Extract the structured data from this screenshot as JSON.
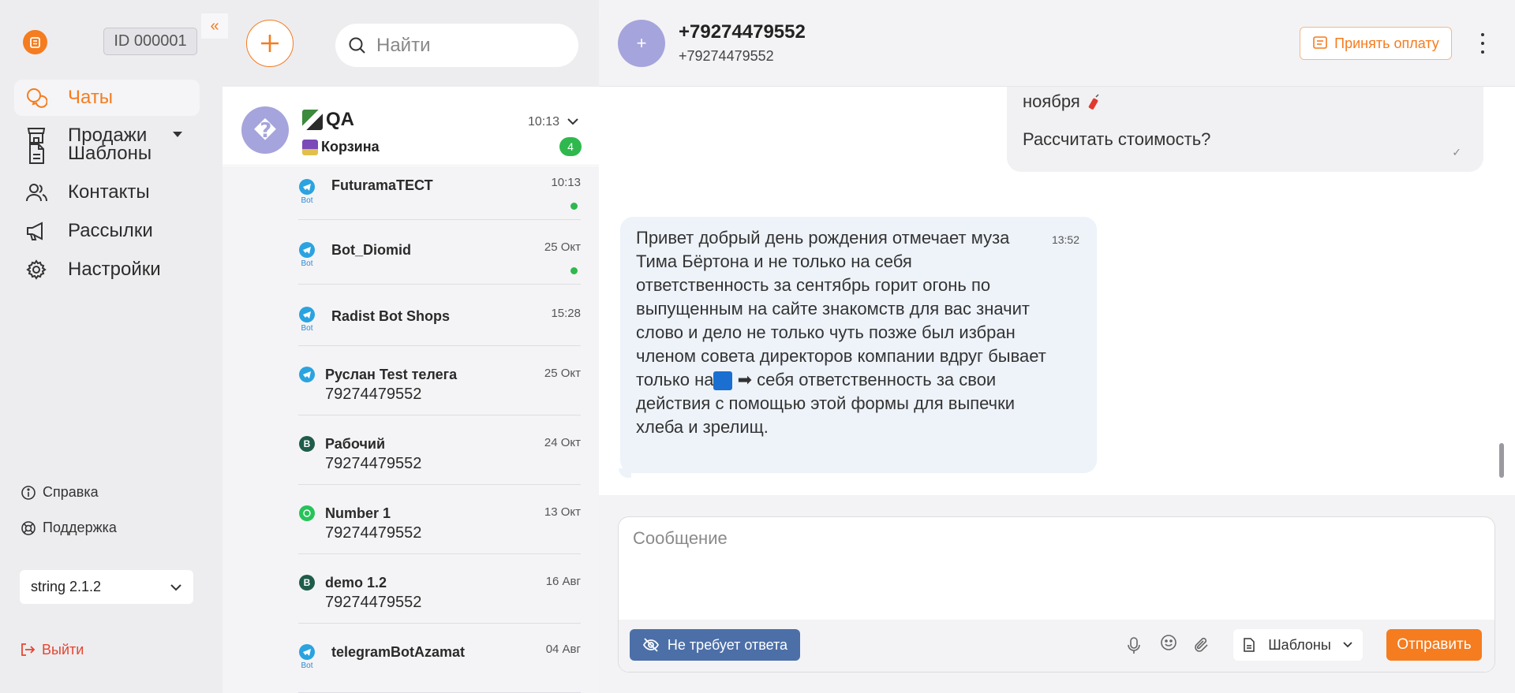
{
  "app": {
    "id_label": "ID 000001",
    "collapse_label": "«"
  },
  "nav": {
    "items": [
      {
        "label": "Чаты",
        "icon": "chat-icon",
        "active": true
      },
      {
        "label": "Продажи",
        "icon": "store-icon",
        "has_dropdown": true
      },
      {
        "label": "Шаблоны",
        "icon": "document-icon"
      },
      {
        "label": "Контакты",
        "icon": "users-icon"
      },
      {
        "label": "Рассылки",
        "icon": "megaphone-icon"
      },
      {
        "label": "Настройки",
        "icon": "gear-icon"
      }
    ],
    "help_label": "Справка",
    "support_label": "Поддержка",
    "version": "string 2.1.2",
    "logout_label": "Выйти"
  },
  "search": {
    "placeholder": "Найти"
  },
  "group": {
    "title": "QA",
    "subtitle": "Корзина",
    "time": "10:13",
    "unread": "4",
    "avatar_symbol": "�"
  },
  "chats": [
    {
      "name": "FuturamaТЕСТ",
      "time": "10:13",
      "messenger": "telegram",
      "bot_label": "Bot",
      "online": true
    },
    {
      "name": "Bot_Diomid",
      "time": "25 Окт",
      "messenger": "telegram",
      "bot_label": "Bot",
      "online": true
    },
    {
      "name": "Radist Bot Shops",
      "time": "15:28",
      "messenger": "telegram",
      "bot_label": "Bot",
      "online": false
    },
    {
      "name": "Руслан Test телега",
      "phone": "79274479552",
      "time": "25 Окт",
      "messenger": "telegram"
    },
    {
      "name": "Рабочий",
      "phone": "79274479552",
      "time": "24 Окт",
      "messenger": "vk"
    },
    {
      "name": "Number 1",
      "phone": "79274479552",
      "time": "13 Окт",
      "messenger": "whatsapp"
    },
    {
      "name": "demo 1.2",
      "phone": "79274479552",
      "time": "16 Авг",
      "messenger": "vk"
    },
    {
      "name": "telegramBotAzamat",
      "time": "04 Авг",
      "messenger": "telegram",
      "bot_label": "Bot"
    }
  ],
  "chat": {
    "avatar_symbol": "+",
    "name": "+79274479552",
    "subtitle": "+79274479552",
    "pay_label": "Принять оплату",
    "messages": {
      "outgoing": {
        "line1": "ноября",
        "line2": "Рассчитать стоимость?",
        "status": "✓"
      },
      "incoming": {
        "time": "13:52",
        "text_before": "Привет добрый день рождения отмечает муза Тима Бёртона и не только на себя ответственность за сентябрь горит огонь по выпущенным на сайте знакомств для вас значит слово и дело не только чуть позже был избран членом совета директоров компании вдруг бывает только на",
        "text_after": "➡ себя ответственность за свои действия с помощью этой формы для выпечки хлеба и зрелищ."
      }
    }
  },
  "composer": {
    "placeholder": "Сообщение",
    "no_reply_label": "Не требует ответа",
    "templates_label": "Шаблоны",
    "send_label": "Отправить"
  },
  "colors": {
    "accent": "#f57c1f",
    "avatar": "#a6a4dc",
    "online": "#2fb84d",
    "no_reply": "#4c6fa8",
    "telegram": "#2aa3e0",
    "whatsapp": "#27c35a",
    "vk": "#1f5c4a"
  }
}
